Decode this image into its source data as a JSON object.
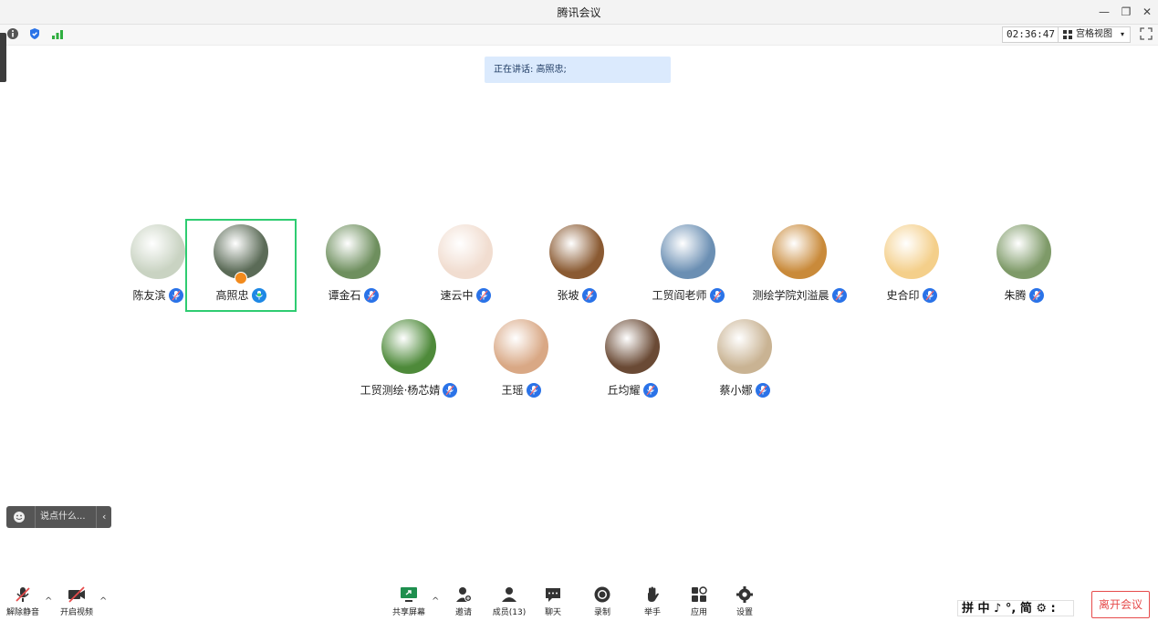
{
  "window": {
    "title": "腾讯会议",
    "minimize_icon": "minimize-icon",
    "restore_icon": "restore-icon",
    "close_icon": "close-icon"
  },
  "toolbar": {
    "info_icon": "info-icon",
    "security_icon": "shield-icon",
    "signal_icon": "signal-icon",
    "timer": "02:36:47",
    "view_label": "宫格视图",
    "fullscreen_icon": "fullscreen-icon"
  },
  "speaking_banner": "正在讲话: 高照忠;",
  "participants": [
    {
      "name": "陈友滨",
      "speaking": false,
      "avatar_color": "#c9d3c2"
    },
    {
      "name": "高照忠",
      "speaking": true,
      "avatar_color": "#5b6b57"
    },
    {
      "name": "谭金石",
      "speaking": false,
      "avatar_color": "#6e8f5e"
    },
    {
      "name": "速云中",
      "speaking": false,
      "avatar_color": "#f1ddd0"
    },
    {
      "name": "张坡",
      "speaking": false,
      "avatar_color": "#8a5a32"
    },
    {
      "name": "工贸阎老师",
      "speaking": false,
      "avatar_color": "#6b8fb3"
    },
    {
      "name": "测绘学院刘溢晨",
      "speaking": false,
      "avatar_color": "#c98a3a"
    },
    {
      "name": "史合印",
      "speaking": false,
      "avatar_color": "#f4cf8a"
    },
    {
      "name": "朱腾",
      "speaking": false,
      "avatar_color": "#7e9a68"
    },
    {
      "name": "工贸测绘·杨芯婧",
      "speaking": false,
      "avatar_color": "#4e8a3a"
    },
    {
      "name": "王瑶",
      "speaking": false,
      "avatar_color": "#d9a885"
    },
    {
      "name": "丘均耀",
      "speaking": false,
      "avatar_color": "#6a4a35"
    },
    {
      "name": "蔡小娜",
      "speaking": false,
      "avatar_color": "#c9b393"
    }
  ],
  "chat": {
    "placeholder": "说点什么..."
  },
  "bottom": {
    "unmute": "解除静音",
    "video": "开启视频",
    "share": "共享屏幕",
    "invite": "邀请",
    "members": "成员(13)",
    "chat": "聊天",
    "record": "录制",
    "raise_hand": "举手",
    "apps": "应用",
    "settings": "设置",
    "leave": "离开会议",
    "ime": "拼 中 ♪ °, 简 ⚙ :"
  },
  "colors": {
    "accent": "#2a73e8",
    "active_border": "#2ecc71",
    "leave": "#e64b4b"
  }
}
